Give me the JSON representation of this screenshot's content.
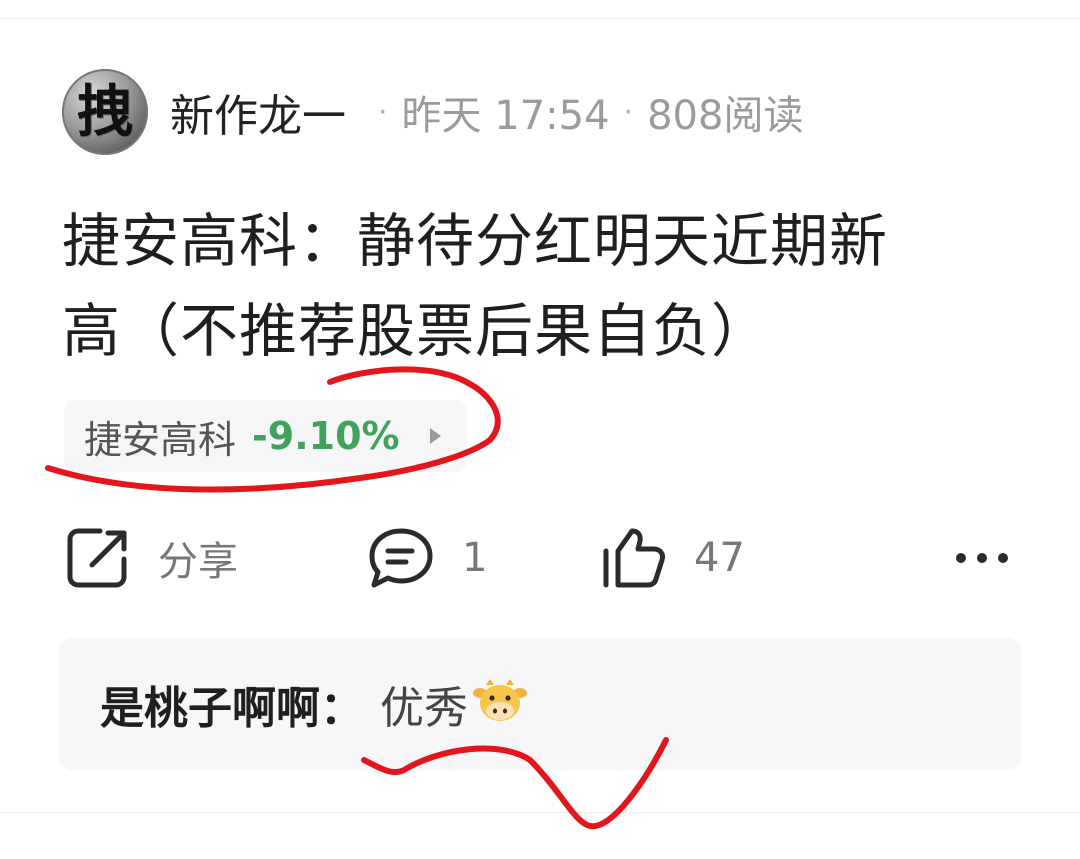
{
  "post": {
    "avatar_glyph": "拽",
    "author": "新作龙一",
    "time": "昨天 17:54",
    "reads": "808阅读",
    "separator": "·",
    "title_line1": "捷安高科：静待分红明天近期新",
    "title_line2": "高（不推荐股票后果自负）"
  },
  "stock": {
    "name": "捷安高科",
    "change": "-9.10%",
    "change_color": "#3fa35b"
  },
  "actions": {
    "share_label": "分享",
    "comment_count": "1",
    "like_count": "47",
    "icons": [
      "share-icon",
      "comment-icon",
      "thumbs-up-icon",
      "more-icon"
    ]
  },
  "comment": {
    "user": "是桃子啊啊",
    "separator": "：",
    "text": "优秀",
    "emoji": "cow-emoji"
  },
  "annotation_color": "#e3161d"
}
